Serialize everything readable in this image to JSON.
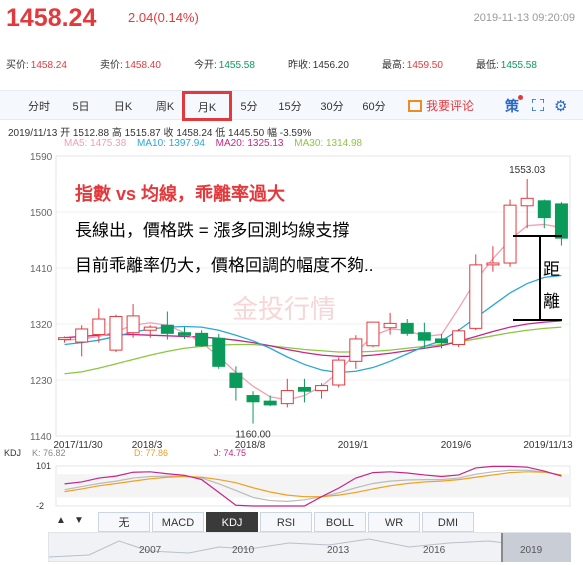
{
  "header": {
    "price": "1458.24",
    "change": "2.04(0.14%)",
    "time": "2019-11-13 09:20:09"
  },
  "quotes": [
    {
      "label": "买价:",
      "value": "1458.24",
      "color": "red"
    },
    {
      "label": "卖价:",
      "value": "1458.40",
      "color": "red"
    },
    {
      "label": "今开:",
      "value": "1455.58",
      "color": "green"
    },
    {
      "label": "昨收:",
      "value": "1456.20",
      "color": "plain"
    },
    {
      "label": "最高:",
      "value": "1459.50",
      "color": "red"
    },
    {
      "label": "最低:",
      "value": "1455.58",
      "color": "green"
    }
  ],
  "tabs": [
    "分时",
    "5日",
    "日K",
    "周K",
    "月K",
    "5分",
    "15分",
    "30分",
    "60分"
  ],
  "active_tab": "月K",
  "toolbar": {
    "comment": "我要评论",
    "ce": "策",
    "settings_icon": "gear-icon",
    "expand_icon": "fullscreen-icon"
  },
  "ohlc": {
    "date": "2019/11/13",
    "open_label": "开",
    "open": "1512.88",
    "high_label": "高",
    "high": "1515.87",
    "close_label": "收",
    "close": "1458.24",
    "low_label": "低",
    "low": "1445.50",
    "amp_label": "幅",
    "amp": "-3.59%"
  },
  "ma_legend": [
    {
      "label": "MA5: 1475.38",
      "color": "#f2a0b4"
    },
    {
      "label": "MA10: 1397.94",
      "color": "#2aa7d8"
    },
    {
      "label": "MA20: 1325.13",
      "color": "#c5258a"
    },
    {
      "label": "MA30: 1314.98",
      "color": "#8cc63f"
    }
  ],
  "annotations": {
    "title": "指數 vs 均線，乖離率過大",
    "line1": "長線出，價格跌 = 漲多回測均線支撐",
    "line2": "目前乖離率仍大，價格回調的幅度不夠..",
    "vertical1": "距",
    "vertical2": "離"
  },
  "watermark": "金投行情",
  "chart_data": {
    "type": "candlestick",
    "y_ticks": [
      "1590",
      "1500",
      "1410",
      "1320",
      "1230",
      "1140"
    ],
    "ylim": [
      1140,
      1590
    ],
    "x_ticks": [
      "2017/11/30",
      "2018/3",
      "2018/8",
      "2019/1",
      "2019/6",
      "2019/11/13"
    ],
    "high_label": "1553.03",
    "low_label": "1160.00",
    "candles": [
      {
        "o": 1295,
        "h": 1300,
        "l": 1290,
        "c": 1298
      },
      {
        "o": 1291,
        "h": 1318,
        "l": 1268,
        "c": 1312
      },
      {
        "o": 1303,
        "h": 1345,
        "l": 1290,
        "c": 1328
      },
      {
        "o": 1278,
        "h": 1335,
        "l": 1275,
        "c": 1332
      },
      {
        "o": 1306,
        "h": 1352,
        "l": 1298,
        "c": 1333
      },
      {
        "o": 1310,
        "h": 1318,
        "l": 1298,
        "c": 1315
      },
      {
        "o": 1318,
        "h": 1340,
        "l": 1295,
        "c": 1305
      },
      {
        "o": 1306,
        "h": 1315,
        "l": 1296,
        "c": 1302
      },
      {
        "o": 1305,
        "h": 1310,
        "l": 1283,
        "c": 1285
      },
      {
        "o": 1297,
        "h": 1304,
        "l": 1248,
        "c": 1252
      },
      {
        "o": 1241,
        "h": 1252,
        "l": 1197,
        "c": 1218
      },
      {
        "o": 1205,
        "h": 1212,
        "l": 1160,
        "c": 1195
      },
      {
        "o": 1196,
        "h": 1205,
        "l": 1188,
        "c": 1190
      },
      {
        "o": 1192,
        "h": 1232,
        "l": 1186,
        "c": 1213
      },
      {
        "o": 1218,
        "h": 1232,
        "l": 1194,
        "c": 1212
      },
      {
        "o": 1213,
        "h": 1225,
        "l": 1200,
        "c": 1221
      },
      {
        "o": 1222,
        "h": 1266,
        "l": 1218,
        "c": 1262
      },
      {
        "o": 1260,
        "h": 1302,
        "l": 1248,
        "c": 1296
      },
      {
        "o": 1285,
        "h": 1322,
        "l": 1283,
        "c": 1323
      },
      {
        "o": 1314,
        "h": 1338,
        "l": 1303,
        "c": 1321
      },
      {
        "o": 1321,
        "h": 1328,
        "l": 1301,
        "c": 1305
      },
      {
        "o": 1306,
        "h": 1322,
        "l": 1280,
        "c": 1294
      },
      {
        "o": 1296,
        "h": 1304,
        "l": 1281,
        "c": 1290
      },
      {
        "o": 1287,
        "h": 1312,
        "l": 1283,
        "c": 1309
      },
      {
        "o": 1313,
        "h": 1432,
        "l": 1310,
        "c": 1415
      },
      {
        "o": 1415,
        "h": 1445,
        "l": 1404,
        "c": 1418
      },
      {
        "o": 1418,
        "h": 1520,
        "l": 1412,
        "c": 1511
      },
      {
        "o": 1510,
        "h": 1553,
        "l": 1474,
        "c": 1522
      },
      {
        "o": 1518,
        "h": 1520,
        "l": 1474,
        "c": 1491
      },
      {
        "o": 1513,
        "h": 1516,
        "l": 1446,
        "c": 1458
      }
    ],
    "ma5": [
      1294,
      1296,
      1300,
      1308,
      1318,
      1322,
      1318,
      1306,
      1290,
      1268,
      1242,
      1220,
      1203,
      1198,
      1205,
      1220,
      1243,
      1274,
      1301,
      1312,
      1310,
      1300,
      1303,
      1345,
      1390,
      1425,
      1455,
      1478,
      1480,
      1475
    ],
    "ma10": [
      1287,
      1290,
      1294,
      1300,
      1307,
      1312,
      1315,
      1316,
      1315,
      1310,
      1302,
      1293,
      1281,
      1267,
      1255,
      1246,
      1242,
      1244,
      1250,
      1260,
      1272,
      1284,
      1293,
      1310,
      1330,
      1350,
      1370,
      1385,
      1395,
      1398
    ],
    "ma20": [
      1298,
      1300,
      1302,
      1303,
      1303,
      1302,
      1301,
      1300,
      1299,
      1297,
      1294,
      1290,
      1285,
      1279,
      1274,
      1270,
      1268,
      1268,
      1270,
      1273,
      1277,
      1281,
      1285,
      1292,
      1300,
      1308,
      1315,
      1320,
      1323,
      1325
    ],
    "ma30": [
      1240,
      1243,
      1249,
      1256,
      1263,
      1270,
      1276,
      1281,
      1284,
      1286,
      1287,
      1287,
      1285,
      1282,
      1279,
      1277,
      1275,
      1275,
      1276,
      1278,
      1281,
      1284,
      1287,
      1291,
      1296,
      1301,
      1306,
      1310,
      1313,
      1315
    ],
    "kdj": {
      "label": "KDJ",
      "k_label": "K: 76.82",
      "d_label": "D: 77.86",
      "j_label": "J: 74.75",
      "ticks": [
        "101",
        "-2"
      ],
      "ylim": [
        -2,
        101
      ],
      "k": [
        40,
        48,
        56,
        62,
        70,
        74,
        75,
        75,
        70,
        55,
        38,
        20,
        12,
        10,
        14,
        22,
        32,
        45,
        56,
        62,
        65,
        66,
        66,
        70,
        80,
        86,
        90,
        90,
        86,
        77
      ],
      "d": [
        35,
        42,
        50,
        56,
        62,
        68,
        72,
        74,
        72,
        66,
        58,
        45,
        34,
        26,
        22,
        22,
        26,
        33,
        42,
        50,
        56,
        60,
        62,
        66,
        72,
        78,
        84,
        86,
        85,
        78
      ],
      "j": [
        55,
        60,
        70,
        75,
        85,
        86,
        81,
        77,
        66,
        33,
        0,
        -2,
        -2,
        -2,
        -2,
        22,
        44,
        70,
        84,
        86,
        83,
        78,
        74,
        78,
        96,
        100,
        100,
        98,
        88,
        75
      ]
    }
  },
  "bottom_tabs": [
    "无",
    "MACD",
    "KDJ",
    "RSI",
    "BOLL",
    "WR",
    "DMI"
  ],
  "active_bottom_tab": "KDJ",
  "timeline_years": [
    "2007",
    "2010",
    "2013",
    "2016",
    "2019"
  ]
}
